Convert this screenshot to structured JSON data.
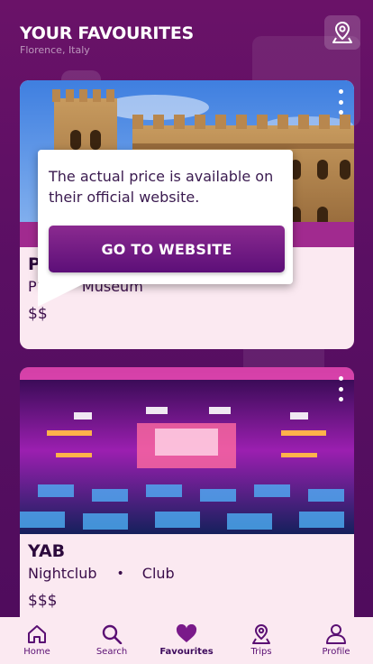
{
  "header": {
    "title": "YOUR FAVOURITES",
    "subtitle": "Florence, Italy"
  },
  "map_button": {
    "icon": "map-pin-icon"
  },
  "cards": [
    {
      "name": "P",
      "tag1": "P",
      "tag2": "Museum",
      "price": "$$"
    },
    {
      "name": "YAB",
      "tag1": "Nightclub",
      "tag2": "Club",
      "price": "$$$"
    }
  ],
  "popup": {
    "text": "The actual price is available on their official website.",
    "button": "GO TO WEBSITE"
  },
  "tabs": [
    {
      "label": "Home",
      "icon": "home-icon"
    },
    {
      "label": "Search",
      "icon": "search-icon"
    },
    {
      "label": "Favourites",
      "icon": "heart-icon",
      "active": true
    },
    {
      "label": "Trips",
      "icon": "trips-pin-icon"
    },
    {
      "label": "Profile",
      "icon": "person-icon"
    }
  ],
  "colors": {
    "accent": "#5c0f78",
    "card_bg": "#fbe9f1",
    "tab_active": "#5a0f73"
  }
}
